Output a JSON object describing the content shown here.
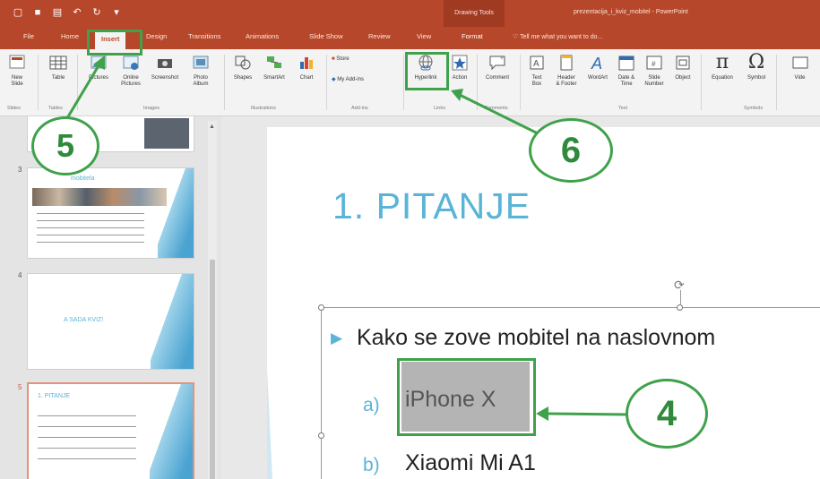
{
  "window": {
    "drawing_tools_label": "Drawing Tools",
    "title": "prezentacija_i_kviz_mobitel - PowerPoint"
  },
  "tabs": [
    "File",
    "Home",
    "Insert",
    "Design",
    "Transitions",
    "Animations",
    "Slide Show",
    "Review",
    "View",
    "Format"
  ],
  "tell_me": "Tell me what you want to do...",
  "ribbon": {
    "buttons": {
      "new_slide": "New\nSlide",
      "table": "Table",
      "pictures": "Pictures",
      "online_pictures": "Online\nPictures",
      "screenshot": "Screenshot",
      "photo_album": "Photo\nAlbum",
      "shapes": "Shapes",
      "smartart": "SmartArt",
      "chart": "Chart",
      "store": "Store",
      "my_addins": "My Add-ins",
      "hyperlink": "Hyperlink",
      "action": "Action",
      "comment": "Comment",
      "text_box": "Text\nBox",
      "header_footer": "Header\n& Footer",
      "wordart": "WordArt",
      "date_time": "Date &\nTime",
      "slide_number": "Slide\nNumber",
      "object": "Object",
      "equation": "Equation",
      "symbol": "Symbol",
      "video": "Vide"
    },
    "groups": {
      "slides": "Slides",
      "tables": "Tables",
      "images": "Images",
      "illustrations": "Illustrations",
      "addins": "Add-ins",
      "links": "Links",
      "comments": "Comments",
      "text": "Text",
      "symbols": "Symbols"
    }
  },
  "thumbnails": [
    {
      "number": "3",
      "title": "mobitela"
    },
    {
      "number": "4",
      "title": "A SADA KVIZ!"
    },
    {
      "number": "5",
      "title": "1. PITANJE"
    }
  ],
  "slide": {
    "title": "1. PITANJE",
    "question": "Kako se zove mobitel na naslovnom",
    "options": [
      {
        "letter": "a)",
        "text": "iPhone X"
      },
      {
        "letter": "b)",
        "text": "Xiaomi Mi A1"
      }
    ]
  },
  "annotations": {
    "step_insert": "5",
    "step_hyperlink": "6",
    "step_select": "4"
  },
  "colors": {
    "accent": "#b7472a",
    "annotation": "#3fa24b",
    "slide_title": "#5ab4d7"
  }
}
